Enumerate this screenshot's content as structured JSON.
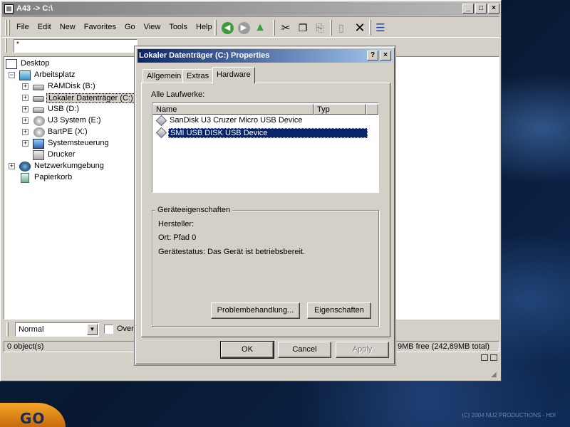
{
  "main_window": {
    "title": "A43 -> C:\\",
    "menu": [
      "File",
      "Edit",
      "New",
      "Favorites",
      "Go",
      "View",
      "Tools",
      "Help"
    ],
    "address_value": "*"
  },
  "tree": [
    {
      "label": "Desktop",
      "icon": "desktop-icon"
    },
    {
      "label": "Arbeitsplatz",
      "icon": "computer-icon"
    },
    {
      "label": "RAMDisk (B:)",
      "icon": "drive-icon"
    },
    {
      "label": "Lokaler Datenträger (C:)",
      "icon": "drive-icon"
    },
    {
      "label": "USB (D:)",
      "icon": "drive-icon"
    },
    {
      "label": "U3 System (E:)",
      "icon": "cd-drive-icon"
    },
    {
      "label": "BartPE (X:)",
      "icon": "cd-drive-icon"
    },
    {
      "label": "Systemsteuerung",
      "icon": "control-panel-icon"
    },
    {
      "label": "Drucker",
      "icon": "printer-icon"
    },
    {
      "label": "Netzwerkumgebung",
      "icon": "network-icon"
    },
    {
      "label": "Papierkorb",
      "icon": "recycle-bin-icon"
    }
  ],
  "bottom_bar": {
    "view_mode": "Normal",
    "checkbox_label": "Over"
  },
  "status": {
    "objects": "0 object(s)",
    "space": "9MB free (242,89MB total)"
  },
  "dialog": {
    "title": "Lokaler Datenträger (C:) Properties",
    "tabs": [
      "Allgemein",
      "Extras",
      "Hardware"
    ],
    "active_tab": "Hardware",
    "all_drives_label": "Alle Laufwerke:",
    "columns": [
      "Name",
      "Typ"
    ],
    "devices": [
      {
        "name": "SanDisk U3 Cruzer Micro USB Device",
        "type": ""
      },
      {
        "name": "SMI USB DISK USB Device",
        "type": ""
      }
    ],
    "selected_device_index": 1,
    "properties_group": "Geräteeigenschaften",
    "manufacturer": "Hersteller:",
    "location": "Ort: Pfad 0",
    "device_status": "Gerätestatus: Das Gerät ist betriebsbereit.",
    "troubleshoot_button": "Problembehandlung...",
    "properties_button": "Eigenschaften",
    "ok_button": "OK",
    "cancel_button": "Cancel",
    "apply_button": "Apply"
  },
  "desktop": {
    "start_label": "GO",
    "copyright": "(C) 2004 NU2 PRODUCTIONS - HDI"
  },
  "colors": {
    "window_face": "#d4d0c8",
    "active_title_start": "#0a246a",
    "active_title_end": "#a6caf0",
    "selection": "#0a246a"
  }
}
